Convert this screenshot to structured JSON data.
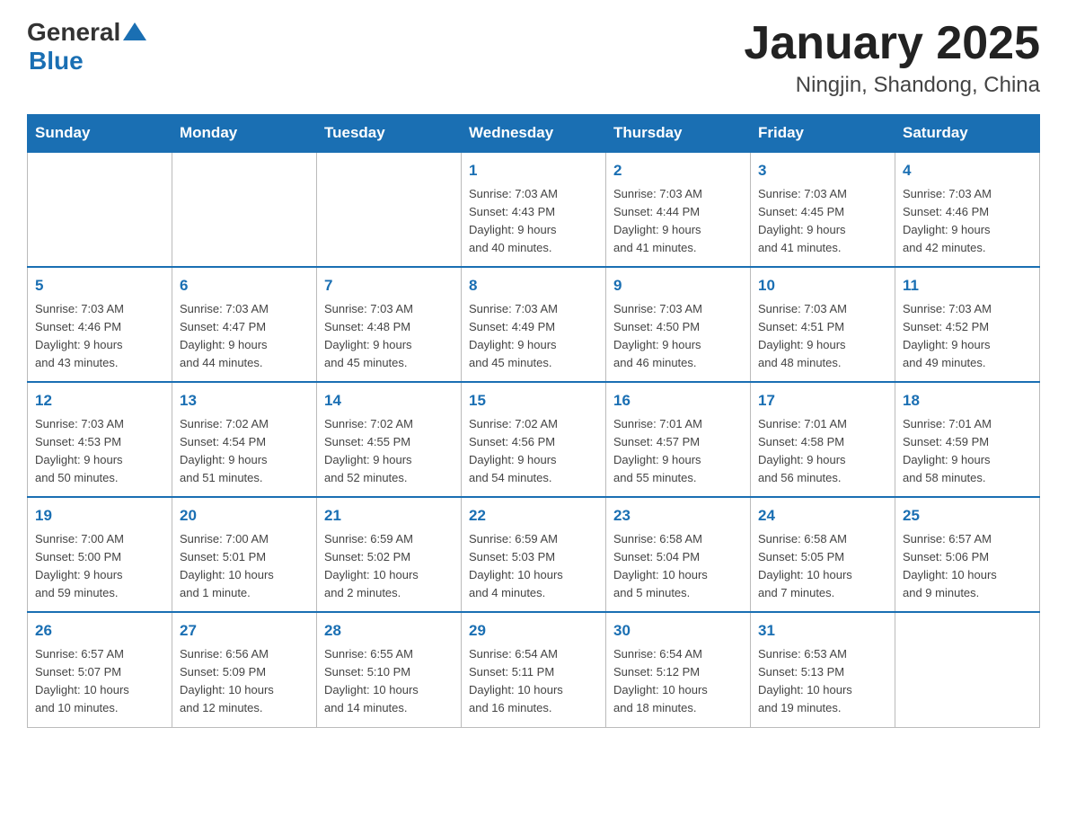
{
  "header": {
    "logo": {
      "general": "General",
      "blue": "Blue"
    },
    "title": "January 2025",
    "subtitle": "Ningjin, Shandong, China"
  },
  "weekdays": [
    "Sunday",
    "Monday",
    "Tuesday",
    "Wednesday",
    "Thursday",
    "Friday",
    "Saturday"
  ],
  "weeks": [
    [
      {
        "day": "",
        "info": ""
      },
      {
        "day": "",
        "info": ""
      },
      {
        "day": "",
        "info": ""
      },
      {
        "day": "1",
        "info": "Sunrise: 7:03 AM\nSunset: 4:43 PM\nDaylight: 9 hours\nand 40 minutes."
      },
      {
        "day": "2",
        "info": "Sunrise: 7:03 AM\nSunset: 4:44 PM\nDaylight: 9 hours\nand 41 minutes."
      },
      {
        "day": "3",
        "info": "Sunrise: 7:03 AM\nSunset: 4:45 PM\nDaylight: 9 hours\nand 41 minutes."
      },
      {
        "day": "4",
        "info": "Sunrise: 7:03 AM\nSunset: 4:46 PM\nDaylight: 9 hours\nand 42 minutes."
      }
    ],
    [
      {
        "day": "5",
        "info": "Sunrise: 7:03 AM\nSunset: 4:46 PM\nDaylight: 9 hours\nand 43 minutes."
      },
      {
        "day": "6",
        "info": "Sunrise: 7:03 AM\nSunset: 4:47 PM\nDaylight: 9 hours\nand 44 minutes."
      },
      {
        "day": "7",
        "info": "Sunrise: 7:03 AM\nSunset: 4:48 PM\nDaylight: 9 hours\nand 45 minutes."
      },
      {
        "day": "8",
        "info": "Sunrise: 7:03 AM\nSunset: 4:49 PM\nDaylight: 9 hours\nand 45 minutes."
      },
      {
        "day": "9",
        "info": "Sunrise: 7:03 AM\nSunset: 4:50 PM\nDaylight: 9 hours\nand 46 minutes."
      },
      {
        "day": "10",
        "info": "Sunrise: 7:03 AM\nSunset: 4:51 PM\nDaylight: 9 hours\nand 48 minutes."
      },
      {
        "day": "11",
        "info": "Sunrise: 7:03 AM\nSunset: 4:52 PM\nDaylight: 9 hours\nand 49 minutes."
      }
    ],
    [
      {
        "day": "12",
        "info": "Sunrise: 7:03 AM\nSunset: 4:53 PM\nDaylight: 9 hours\nand 50 minutes."
      },
      {
        "day": "13",
        "info": "Sunrise: 7:02 AM\nSunset: 4:54 PM\nDaylight: 9 hours\nand 51 minutes."
      },
      {
        "day": "14",
        "info": "Sunrise: 7:02 AM\nSunset: 4:55 PM\nDaylight: 9 hours\nand 52 minutes."
      },
      {
        "day": "15",
        "info": "Sunrise: 7:02 AM\nSunset: 4:56 PM\nDaylight: 9 hours\nand 54 minutes."
      },
      {
        "day": "16",
        "info": "Sunrise: 7:01 AM\nSunset: 4:57 PM\nDaylight: 9 hours\nand 55 minutes."
      },
      {
        "day": "17",
        "info": "Sunrise: 7:01 AM\nSunset: 4:58 PM\nDaylight: 9 hours\nand 56 minutes."
      },
      {
        "day": "18",
        "info": "Sunrise: 7:01 AM\nSunset: 4:59 PM\nDaylight: 9 hours\nand 58 minutes."
      }
    ],
    [
      {
        "day": "19",
        "info": "Sunrise: 7:00 AM\nSunset: 5:00 PM\nDaylight: 9 hours\nand 59 minutes."
      },
      {
        "day": "20",
        "info": "Sunrise: 7:00 AM\nSunset: 5:01 PM\nDaylight: 10 hours\nand 1 minute."
      },
      {
        "day": "21",
        "info": "Sunrise: 6:59 AM\nSunset: 5:02 PM\nDaylight: 10 hours\nand 2 minutes."
      },
      {
        "day": "22",
        "info": "Sunrise: 6:59 AM\nSunset: 5:03 PM\nDaylight: 10 hours\nand 4 minutes."
      },
      {
        "day": "23",
        "info": "Sunrise: 6:58 AM\nSunset: 5:04 PM\nDaylight: 10 hours\nand 5 minutes."
      },
      {
        "day": "24",
        "info": "Sunrise: 6:58 AM\nSunset: 5:05 PM\nDaylight: 10 hours\nand 7 minutes."
      },
      {
        "day": "25",
        "info": "Sunrise: 6:57 AM\nSunset: 5:06 PM\nDaylight: 10 hours\nand 9 minutes."
      }
    ],
    [
      {
        "day": "26",
        "info": "Sunrise: 6:57 AM\nSunset: 5:07 PM\nDaylight: 10 hours\nand 10 minutes."
      },
      {
        "day": "27",
        "info": "Sunrise: 6:56 AM\nSunset: 5:09 PM\nDaylight: 10 hours\nand 12 minutes."
      },
      {
        "day": "28",
        "info": "Sunrise: 6:55 AM\nSunset: 5:10 PM\nDaylight: 10 hours\nand 14 minutes."
      },
      {
        "day": "29",
        "info": "Sunrise: 6:54 AM\nSunset: 5:11 PM\nDaylight: 10 hours\nand 16 minutes."
      },
      {
        "day": "30",
        "info": "Sunrise: 6:54 AM\nSunset: 5:12 PM\nDaylight: 10 hours\nand 18 minutes."
      },
      {
        "day": "31",
        "info": "Sunrise: 6:53 AM\nSunset: 5:13 PM\nDaylight: 10 hours\nand 19 minutes."
      },
      {
        "day": "",
        "info": ""
      }
    ]
  ]
}
